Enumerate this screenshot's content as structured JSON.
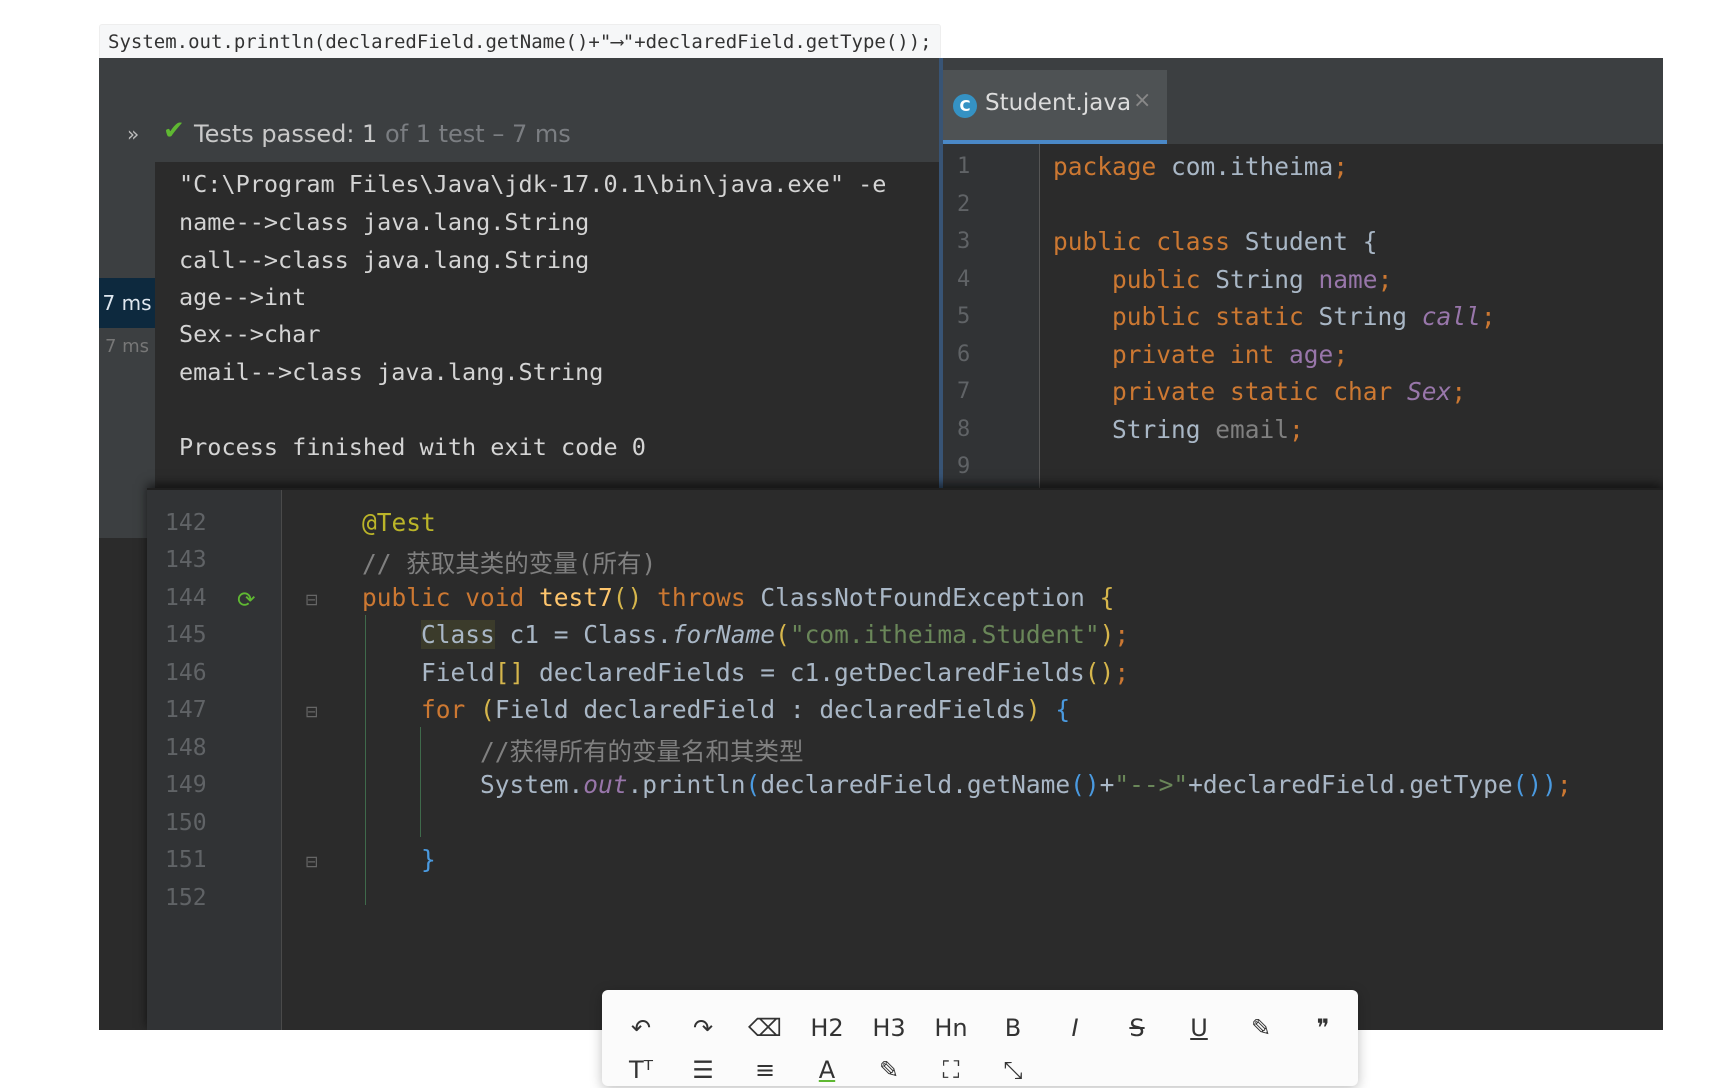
{
  "top_snippet": "System.out.println(declaredField.getName()+\"⟶\"+declaredField.getType());",
  "run": {
    "chevron": "»",
    "status_main": "Tests passed: 1",
    "status_dim": " of 1 test – 7 ms",
    "tree_selected": "7 ms",
    "tree_item": "7 ms",
    "console": [
      "\"C:\\Program Files\\Java\\jdk-17.0.1\\bin\\java.exe\" -e",
      "name-->class java.lang.String",
      "call-->class java.lang.String",
      "age-->int",
      "Sex-->char",
      "email-->class java.lang.String",
      "",
      "Process finished with exit code 0"
    ]
  },
  "student": {
    "tab_icon": "C",
    "tab_name": "Student.java",
    "tab_close": "×",
    "line_numbers": [
      "1",
      "2",
      "3",
      "4",
      "5",
      "6",
      "7",
      "8",
      "9"
    ]
  },
  "main": {
    "line_numbers": [
      "142",
      "143",
      "144",
      "145",
      "146",
      "147",
      "148",
      "149",
      "150",
      "151",
      "152"
    ],
    "comment1": "// 获取其类的变量(所有)",
    "comment2": "//获得所有的变量名和其类型",
    "string_class": "\"com.itheima.Student\"",
    "string_arrow": "\"-->\""
  },
  "toolbar": {
    "undo": "↶",
    "redo": "↷",
    "eraser": "⌫",
    "h2": "H2",
    "h3": "H3",
    "hn": "Hn",
    "bold": "B",
    "italic": "I",
    "strike": "S",
    "underline": "U",
    "highlight": "✎",
    "quote": "❞",
    "row2": [
      "Tᵀ",
      "☰",
      "≡",
      "A",
      "✎",
      "⛶",
      "⤡"
    ]
  }
}
